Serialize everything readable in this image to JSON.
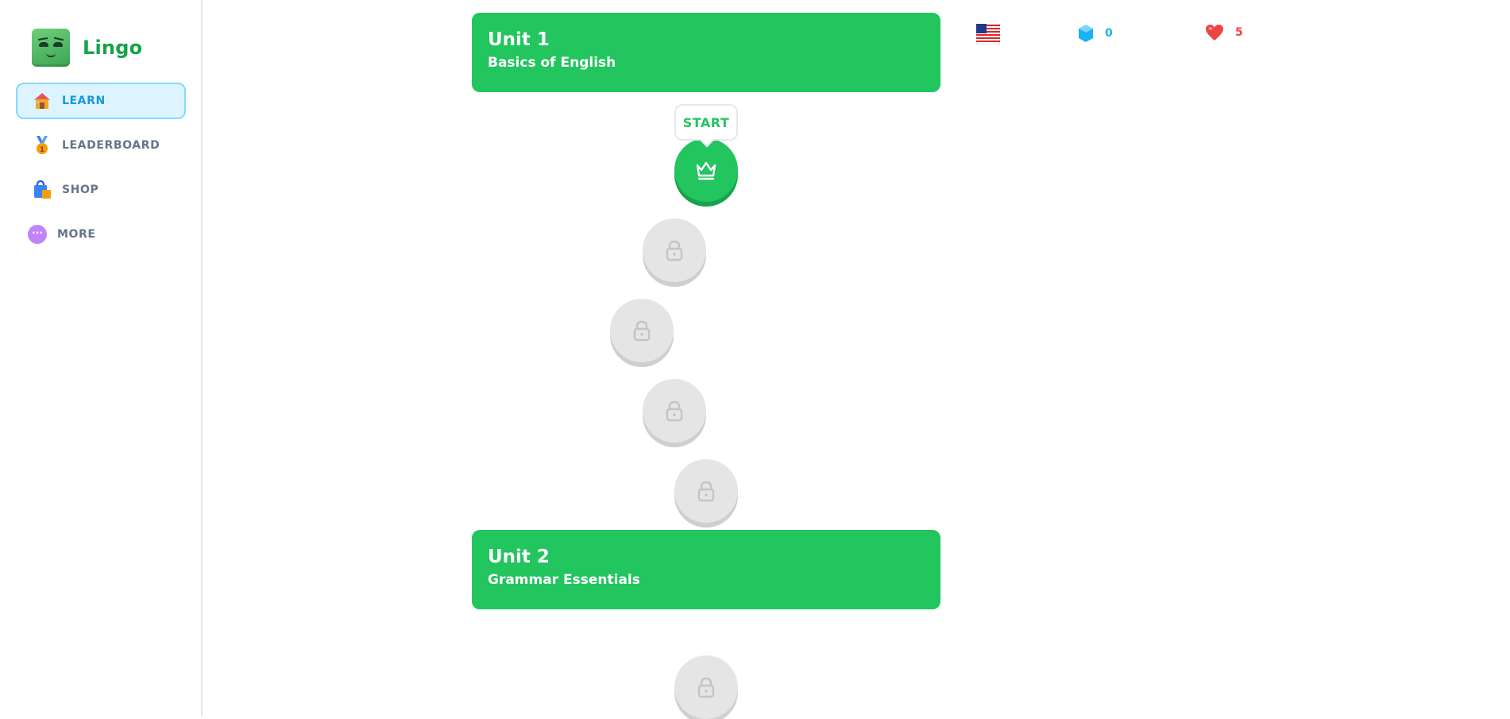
{
  "brand": {
    "name": "Lingo"
  },
  "sidebar": {
    "items": [
      {
        "label": "LEARN",
        "icon": "house-icon",
        "active": true
      },
      {
        "label": "LEADERBOARD",
        "icon": "medal-icon",
        "active": false
      },
      {
        "label": "SHOP",
        "icon": "shopping-bag-icon",
        "active": false
      },
      {
        "label": "MORE",
        "icon": "more-icon",
        "active": false
      }
    ]
  },
  "units": [
    {
      "title": "Unit 1",
      "subtitle": "Basics of English"
    },
    {
      "title": "Unit 2",
      "subtitle": "Grammar Essentials"
    }
  ],
  "lesson_path": {
    "start_label": "START",
    "active_icon": "crown-icon",
    "locked_icon": "lock-icon"
  },
  "header": {
    "language": {
      "icon": "us-flag-icon"
    },
    "gems": {
      "value": "0",
      "icon": "gem-icon",
      "color": "#1cb0f6"
    },
    "hearts": {
      "value": "5",
      "icon": "heart-icon",
      "color": "#ef4444"
    }
  },
  "colors": {
    "accent": "#22c55e",
    "accent_dark": "#16a34a",
    "active_nav_bg": "#ddf4ff",
    "active_nav_border": "#84d8ff",
    "locked": "#e5e5e5"
  }
}
